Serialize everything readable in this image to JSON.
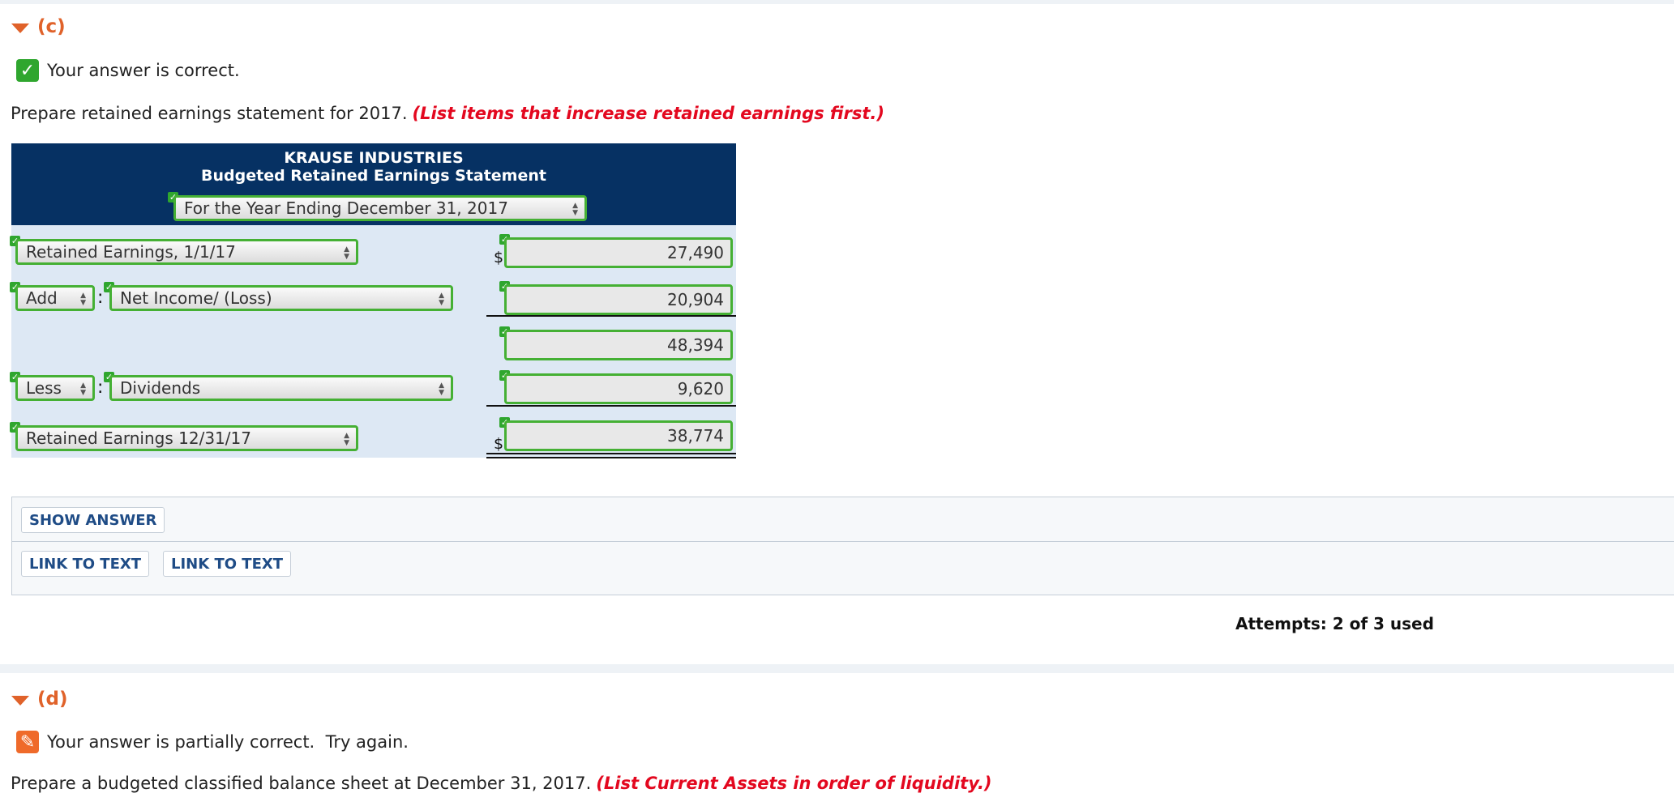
{
  "part_c": {
    "label": "(c)",
    "status_text": "Your answer is correct.",
    "prompt": "Prepare retained earnings statement for 2017.",
    "hint": "(List items that increase retained earnings first.)",
    "statement": {
      "company": "KRAUSE INDUSTRIES",
      "title": "Budgeted Retained Earnings Statement",
      "period": "For the Year Ending December 31, 2017",
      "rows": [
        {
          "label": "Retained Earnings, 1/1/17",
          "value": "27,490",
          "currency": "$"
        },
        {
          "operator": "Add",
          "label": "Net Income/ (Loss)",
          "value": "20,904"
        },
        {
          "value": "48,394"
        },
        {
          "operator": "Less",
          "label": "Dividends",
          "value": "9,620"
        },
        {
          "label": "Retained Earnings 12/31/17",
          "value": "38,774",
          "currency": "$"
        }
      ]
    },
    "buttons": {
      "show_answer": "SHOW ANSWER",
      "link_to_text_1": "LINK TO TEXT",
      "link_to_text_2": "LINK TO TEXT"
    },
    "attempts": "Attempts: 2 of 3 used"
  },
  "part_d": {
    "label": "(d)",
    "status_text": "Your answer is partially correct.  Try again.",
    "prompt": "Prepare a budgeted classified balance sheet at December 31, 2017.",
    "hint": "(List Current Assets in order of liquidity.)"
  },
  "colors": {
    "accent_orange": "#e0622a",
    "correct_green": "#2fa62e",
    "header_navy": "#063163",
    "hint_red": "#e3081f",
    "link_blue": "#1f4c86"
  },
  "icons": {
    "collapse": "triangle-down-icon",
    "correct": "check-icon",
    "partial": "pencil-icon"
  }
}
